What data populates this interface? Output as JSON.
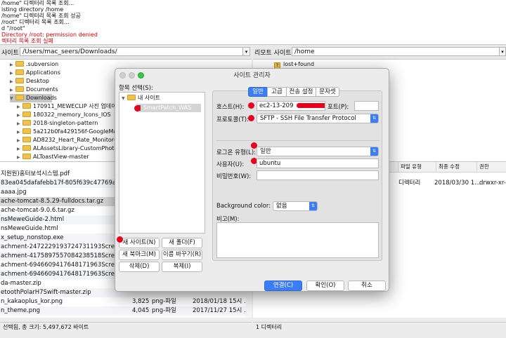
{
  "log": {
    "lines": [
      {
        "text": "/home\" 디렉터리 목록 조회...",
        "err": false
      },
      {
        "text": "isting directory /home",
        "err": false
      },
      {
        "text": "/home\" 디렉터리 목록 조회 성공",
        "err": false
      },
      {
        "text": "/root\" 디렉터리 목록 조회...",
        "err": false
      },
      {
        "text": "d \"/root\"",
        "err": false
      },
      {
        "text": "Directory /root: permission denied",
        "err": true
      },
      {
        "text": "렉터리 목록 조회 실패",
        "err": true
      }
    ]
  },
  "local": {
    "site_label": "사이트:",
    "path": "/Users/mac_seers/Downloads/",
    "tree": [
      {
        "label": ".subversion",
        "indent": 1,
        "open": false,
        "selected": false
      },
      {
        "label": "Applications",
        "indent": 1,
        "open": false,
        "selected": false
      },
      {
        "label": "Desktop",
        "indent": 1,
        "open": false,
        "selected": false
      },
      {
        "label": "Documents",
        "indent": 1,
        "open": false,
        "selected": false
      },
      {
        "label": "Downloads",
        "indent": 1,
        "open": true,
        "selected": true
      },
      {
        "label": "170911_MEWECLIP 사진 업데이트",
        "indent": 2,
        "open": false,
        "selected": false
      },
      {
        "label": "180322_memory_Icons_IOS",
        "indent": 2,
        "open": false,
        "selected": false
      },
      {
        "label": "2018-singleton-pattern",
        "indent": 2,
        "open": false,
        "selected": false
      },
      {
        "label": "5a212b0fa429156f-GoogleMaps-1",
        "indent": 2,
        "open": false,
        "selected": false
      },
      {
        "label": "AD8232_Heart_Rate_Monitor-mas",
        "indent": 2,
        "open": false,
        "selected": false
      },
      {
        "label": "ALAssetsLibrary-CustomPhotoAlb",
        "indent": 2,
        "open": false,
        "selected": false
      },
      {
        "label": "ALToastView-master",
        "indent": 2,
        "open": false,
        "selected": false
      }
    ],
    "files": [
      {
        "name": "지원원)홈터보석시스템.pdf",
        "size": "",
        "type": "",
        "date": ""
      },
      {
        "name": "83ea045dafafebb17f-805f639c47769a...",
        "size": "",
        "type": "",
        "date": ""
      },
      {
        "name": "aaaa.jpg",
        "size": "",
        "type": "",
        "date": ""
      },
      {
        "name": "ache-tomcat-8.5.29-fulldocs.tar.gz",
        "size": "",
        "type": "",
        "date": ""
      },
      {
        "name": "ache-tomcat-9.0.6.tar.gz",
        "size": "",
        "type": "",
        "date": ""
      },
      {
        "name": "nsMeweGuide-2.html",
        "size": "",
        "type": "",
        "date": ""
      },
      {
        "name": "nsMeweGuide.html",
        "size": "",
        "type": "",
        "date": ""
      },
      {
        "name": "x_setup_nonstop.exe",
        "size": "",
        "type": "",
        "date": ""
      },
      {
        "name": "achment-2472229193724731193Screen...",
        "size": "",
        "type": "",
        "date": ""
      },
      {
        "name": "achment-4175897557084238518Screen...",
        "size": "",
        "type": "",
        "date": ""
      },
      {
        "name": "achment-6946609417648171963Screen...",
        "size": "",
        "type": "",
        "date": ""
      },
      {
        "name": "achment-6946609417648171963Screen...",
        "size": "",
        "type": "",
        "date": ""
      },
      {
        "name": "da-master.zip",
        "size": "",
        "type": "",
        "date": ""
      },
      {
        "name": "etoothPolarH7Swift-master.zip",
        "size": "",
        "type": "",
        "date": ""
      },
      {
        "name": "n_kakaoplus_kor.png",
        "size": "3,825",
        "type": "png-파일",
        "date": "2018/01/18 15시 ."
      },
      {
        "name": "n_theme.png",
        "size": "4,045",
        "type": "png-파일",
        "date": "2017/11/27 15시 ."
      }
    ],
    "status": "선택됨, 총 크기: 5,497,672 바이트"
  },
  "remote": {
    "site_label": "리모트 사이트:",
    "path": "/home",
    "tree_item": "lost+found",
    "tree_icon": "?",
    "headers": [
      "파일 유형",
      "최종 수정",
      "권한"
    ],
    "row": {
      "type": "디렉터리",
      "date": "2018/03/30 1...",
      "perm": "drwxr-xr-"
    },
    "status": "1 디렉터리"
  },
  "dialog": {
    "title": "사이트 관리자",
    "entries_label": "항목 선택(S):",
    "root_label": "내 사이트",
    "site_name": "SmartPatch_WAS",
    "buttons": {
      "new_site": "새 사이트(N)",
      "new_folder": "새 폴더(F)",
      "new_bookmark": "새 북마크(M)",
      "rename": "이름 바꾸기(R)",
      "delete": "삭제(D)",
      "copy": "복제(I)"
    },
    "tabs": [
      "일반",
      "고급",
      "전송 설정",
      "문자셋"
    ],
    "host_label": "호스트(H):",
    "host_value": "ec2-13-209",
    "host_tail": "r",
    "port_label": "포트(P):",
    "port_value": "",
    "protocol_label": "프로토콜(T):",
    "protocol_value": "SFTP - SSH File Transfer Protocol",
    "logon_label": "로그온 유형(L):",
    "logon_value": "일반",
    "user_label": "사용자(U):",
    "user_value": "ubuntu",
    "password_label": "비밀번호(W):",
    "password_value": "",
    "bg_label": "Background color:",
    "bg_value": "없음",
    "comments_label": "비고(M):",
    "connect": "연결(C)",
    "ok": "확인(O)",
    "cancel": "취소"
  },
  "colors": {
    "accent": "#3a7df5",
    "annotation_dot": "#e8001c",
    "folder": "#f0c24c"
  }
}
